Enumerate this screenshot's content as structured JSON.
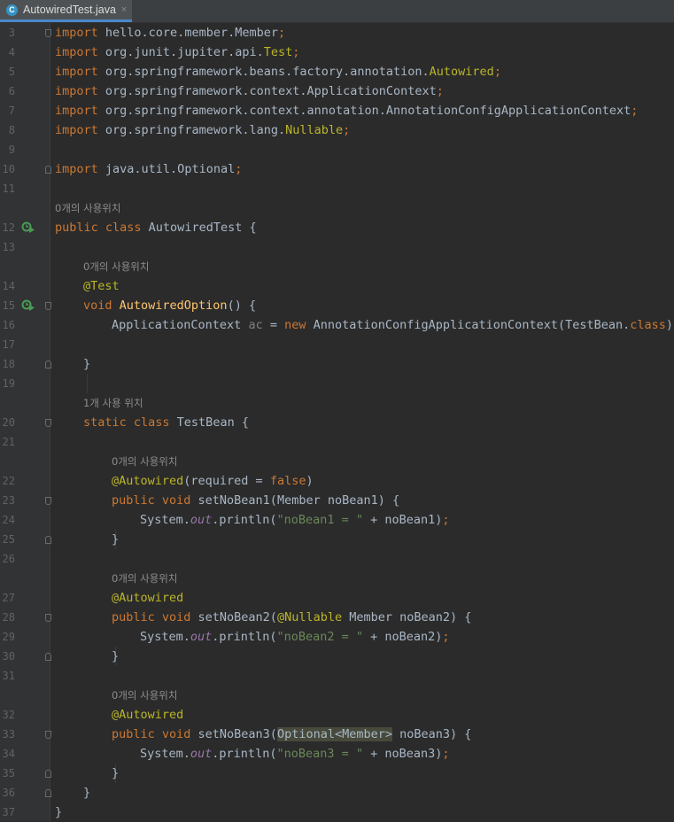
{
  "tab": {
    "label": "AutowiredTest.java",
    "icon": "java-class-icon",
    "close": "×"
  },
  "hints": {
    "zero_usages": "0개의 사용위치",
    "one_usage": "1개 사용 위치"
  },
  "lines": {
    "3": {
      "n": "3",
      "t1": "import",
      "t2": " hello.core.member.Member",
      "t3": ";"
    },
    "4": {
      "n": "4",
      "t1": "import",
      "t2": " org.junit.jupiter.api.",
      "t3": "Test",
      "t4": ";"
    },
    "5": {
      "n": "5",
      "t1": "import",
      "t2": " org.springframework.beans.factory.annotation.",
      "t3": "Autowired",
      "t4": ";"
    },
    "6": {
      "n": "6",
      "t1": "import",
      "t2": " org.springframework.context.ApplicationContext",
      "t3": ";"
    },
    "7": {
      "n": "7",
      "t1": "import",
      "t2": " org.springframework.context.annotation.AnnotationConfigApplicationContext",
      "t3": ";"
    },
    "8": {
      "n": "8",
      "t1": "import",
      "t2": " org.springframework.lang.",
      "t3": "Nullable",
      "t4": ";"
    },
    "9": {
      "n": "9"
    },
    "10": {
      "n": "10",
      "t1": "import",
      "t2": " java.util.Optional",
      "t3": ";"
    },
    "11": {
      "n": "11"
    },
    "12": {
      "n": "12",
      "t1": "public class",
      "t2": " AutowiredTest {"
    },
    "13": {
      "n": "13"
    },
    "14": {
      "n": "14",
      "t1": "@Test"
    },
    "15": {
      "n": "15",
      "t1": "void ",
      "t2": "AutowiredOption",
      "t3": "() {"
    },
    "16": {
      "n": "16",
      "t1": "ApplicationContext ",
      "t2": "ac",
      "t3": " = ",
      "t4": "new",
      "t5": " AnnotationConfigApplicationContext(TestBean.",
      "t6": "class",
      "t7": ");"
    },
    "17": {
      "n": "17"
    },
    "18": {
      "n": "18",
      "t1": "}"
    },
    "19": {
      "n": "19"
    },
    "20": {
      "n": "20",
      "t1": "static class",
      "t2": " TestBean {"
    },
    "21": {
      "n": "21"
    },
    "22": {
      "n": "22",
      "t1": "@Autowired",
      "t2": "(required = ",
      "t3": "false",
      "t4": ")"
    },
    "23": {
      "n": "23",
      "t1": "public void",
      "t2": " setNoBean1(Member noBean1) {"
    },
    "24": {
      "n": "24",
      "t1": "System.",
      "t2": "out",
      "t3": ".println(",
      "t4": "\"noBean1 = \"",
      "t5": " + noBean1)",
      "t6": ";"
    },
    "25": {
      "n": "25",
      "t1": "}"
    },
    "26": {
      "n": "26"
    },
    "27": {
      "n": "27",
      "t1": "@Autowired"
    },
    "28": {
      "n": "28",
      "t1": "public void",
      "t2": " setNoBean2(",
      "t3": "@Nullable",
      "t4": " Member noBean2) {"
    },
    "29": {
      "n": "29",
      "t1": "System.",
      "t2": "out",
      "t3": ".println(",
      "t4": "\"noBean2 = \"",
      "t5": " + noBean2)",
      "t6": ";"
    },
    "30": {
      "n": "30",
      "t1": "}"
    },
    "31": {
      "n": "31"
    },
    "32": {
      "n": "32",
      "t1": "@Autowired"
    },
    "33": {
      "n": "33",
      "t1": "public void",
      "t2": " setNoBean3(",
      "t3": "Optional<Member>",
      "t4": " noBean3) {"
    },
    "34": {
      "n": "34",
      "t1": "System.",
      "t2": "out",
      "t3": ".println(",
      "t4": "\"noBean3 = \"",
      "t5": " + noBean3)",
      "t6": ";"
    },
    "35": {
      "n": "35",
      "t1": "}"
    },
    "36": {
      "n": "36",
      "t1": "}"
    },
    "37": {
      "n": "37",
      "t1": "}"
    }
  },
  "colors": {
    "background": "#2b2b2b",
    "keyword": "#cc7832",
    "annotation": "#bbb529",
    "string": "#6a8759",
    "field": "#9876aa",
    "method": "#ffc66d",
    "text": "#a9b7c6",
    "tab_accent": "#4a88c7"
  },
  "gutter_icons": {
    "run_class": "run-test-icon",
    "run_method": "run-test-icon"
  }
}
